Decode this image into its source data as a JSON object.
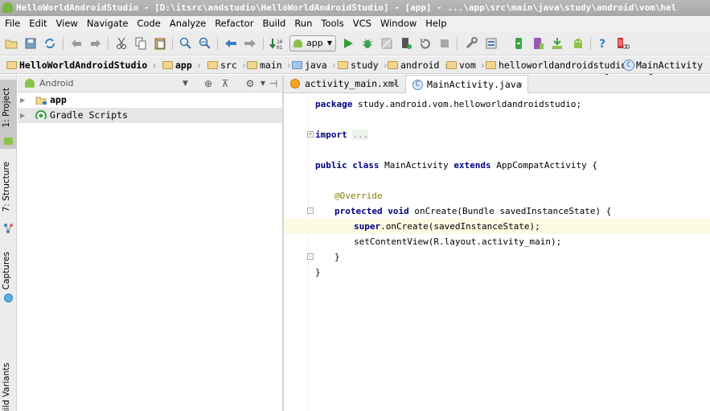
{
  "window": {
    "title": "HelloWorldAndroidStudio - [D:\\itsrc\\andstudio\\HelloWorldAndroidStudio] - [app] - ...\\app\\src\\main\\java\\study\\android\\vom\\hel"
  },
  "menu": [
    "File",
    "Edit",
    "View",
    "Navigate",
    "Code",
    "Analyze",
    "Refactor",
    "Build",
    "Run",
    "Tools",
    "VCS",
    "Window",
    "Help"
  ],
  "toolbar": {
    "run_config": "app"
  },
  "breadcrumbs": [
    "HelloWorldAndroidStudio",
    "app",
    "src",
    "main",
    "java",
    "study",
    "android",
    "vom",
    "helloworldandroidstudio",
    "MainActivity"
  ],
  "left_strip": {
    "tabs": [
      "1: Project",
      "7: Structure",
      "Captures",
      "Build Variants"
    ]
  },
  "project_panel": {
    "view_selector": "Android",
    "tree": [
      {
        "label": "app"
      },
      {
        "label": "Gradle Scripts"
      }
    ]
  },
  "editor_tabs": [
    {
      "label": "activity_main.xml",
      "close": "×"
    },
    {
      "label": "MainActivity.java",
      "close": "×"
    }
  ],
  "code": {
    "package_kw": "package",
    "package_name": " study.android.vom.helloworldandroidstudio;",
    "import_kw": "import",
    "import_dots": "...",
    "class_public": "public",
    "class_kw": "class",
    "class_name": " MainActivity ",
    "extends_kw": "extends",
    "extends_name": " AppCompatActivity {",
    "annotation": "@Override",
    "method_protected": "protected",
    "method_void": "void",
    "method_sig": " onCreate(Bundle savedInstanceState) {",
    "super_kw": "super",
    "super_call": ".onCreate(savedInstanceState);",
    "set_content": "setContentView(R.layout.activity_main);",
    "close_method": "}",
    "close_class": "}"
  },
  "colors": {
    "highlight_circle": "#7a1a1a",
    "keyword": "#000080",
    "annotation": "#808000",
    "current_line": "#fcfae3"
  }
}
